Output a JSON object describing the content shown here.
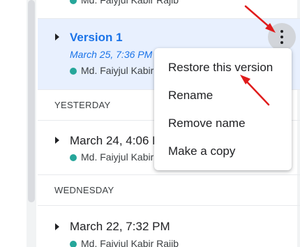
{
  "versions": [
    {
      "title": "",
      "date": "",
      "author": "Md. Faiyjul Kabir Rajib"
    },
    {
      "title": "Version 1",
      "date": "March 25, 7:36 PM",
      "author": "Md. Faiyjul Kabir Rajib"
    },
    {
      "title": "March 24, 4:06 PM",
      "author": "Md. Faiyjul Kabir Rajib"
    },
    {
      "title": "March 22, 7:32 PM",
      "author": "Md. Faiyjul Kabir Rajib"
    }
  ],
  "sections": {
    "yesterday": "YESTERDAY",
    "wednesday": "WEDNESDAY"
  },
  "context_menu": {
    "items": [
      "Restore this version",
      "Rename",
      "Remove name",
      "Make a copy"
    ]
  },
  "annotation": {
    "arrow_color": "#e01b1b"
  },
  "colors": {
    "accent": "#1a73e8",
    "selected_bg": "#e8f0fe",
    "author_dot": "#26a69a"
  }
}
